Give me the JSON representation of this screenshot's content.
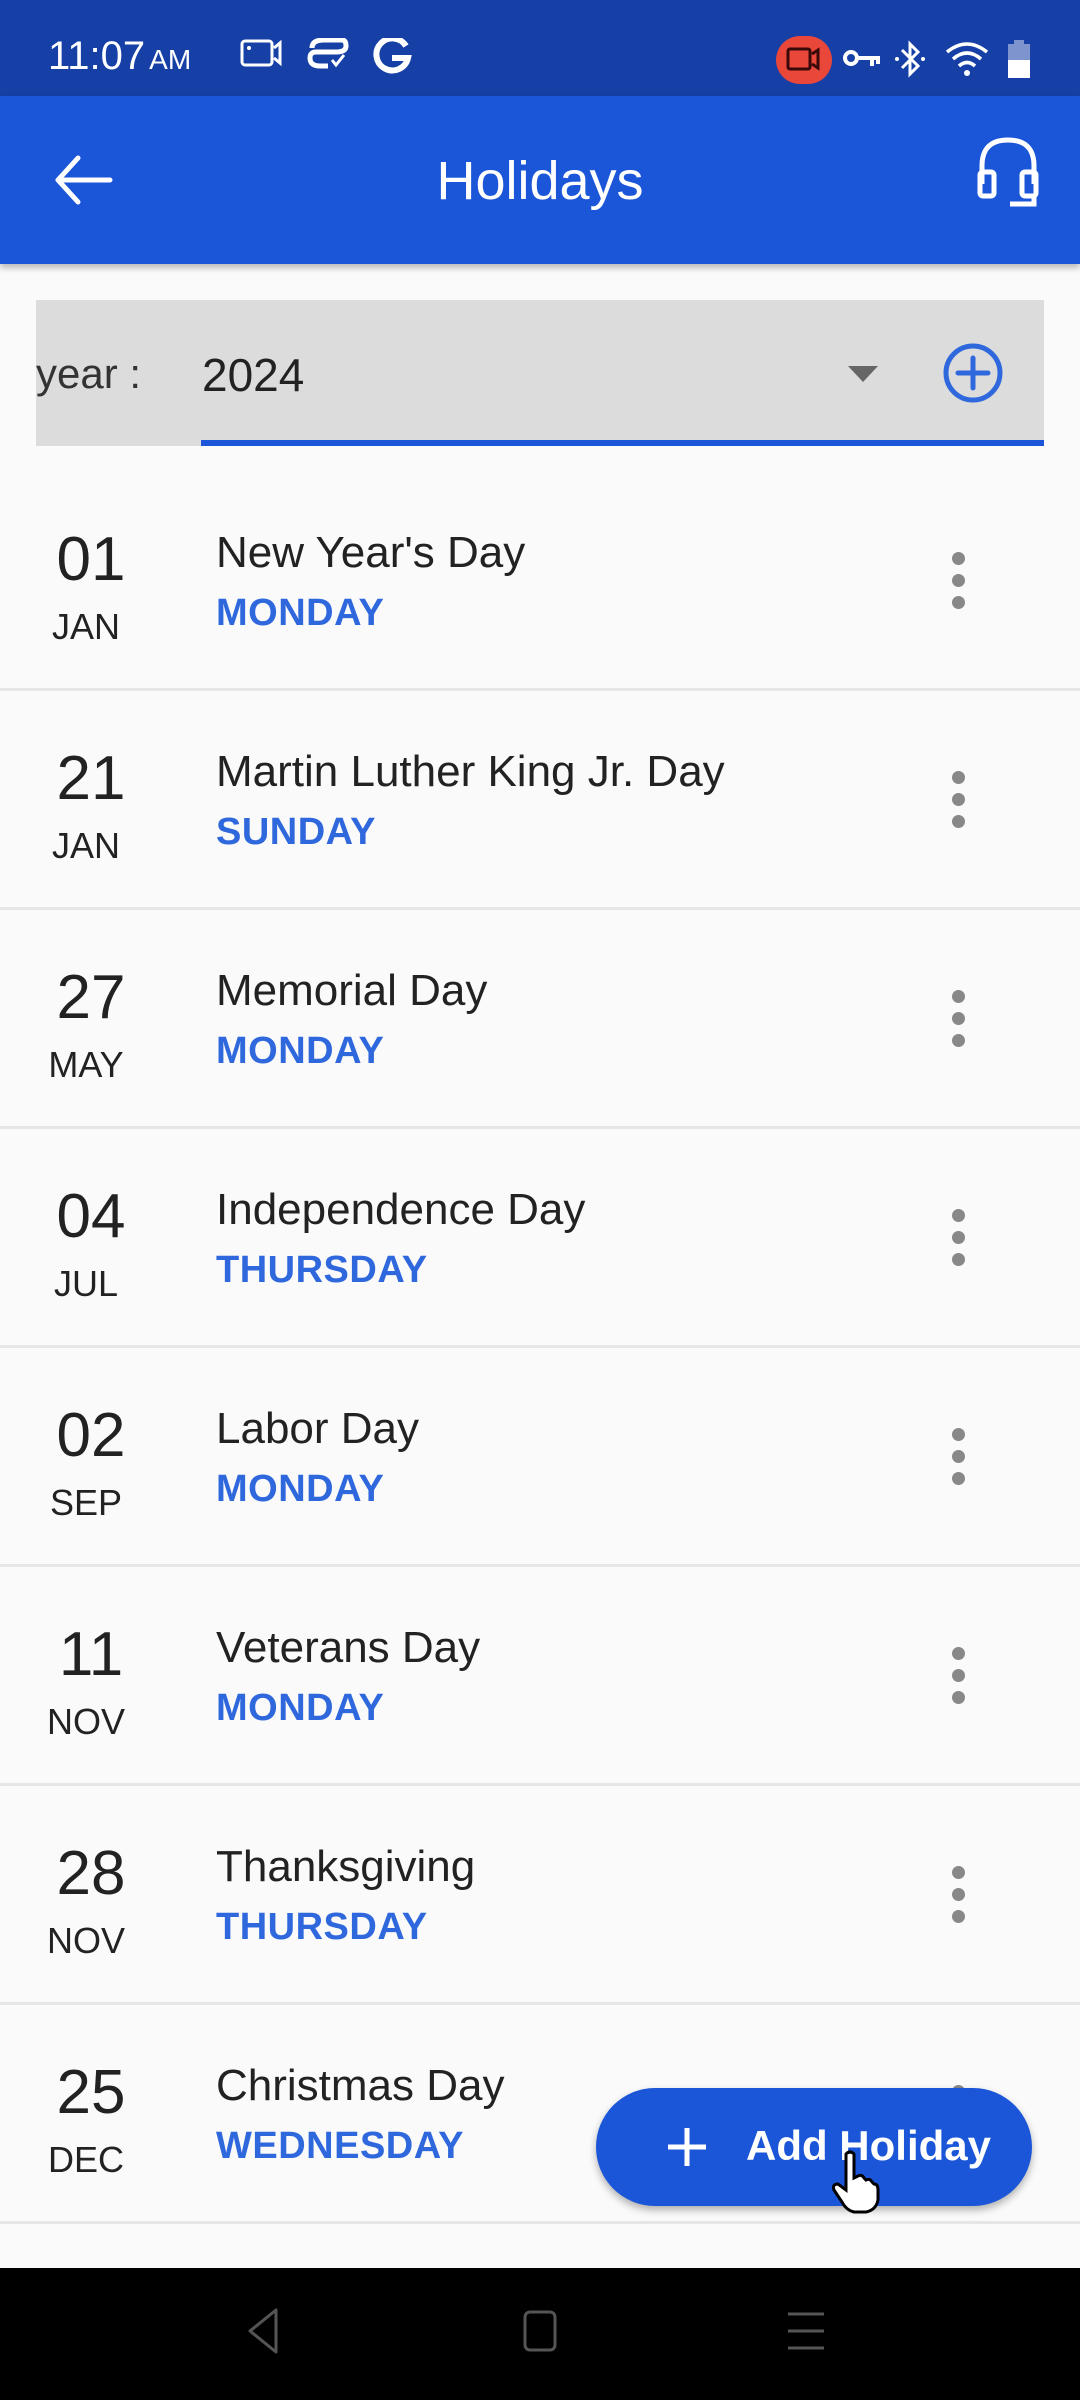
{
  "status_bar": {
    "time": "11:07",
    "ampm": "AM",
    "left_icons": [
      "screen-record-icon",
      "sync-check-icon",
      "google-icon"
    ],
    "right_icons": [
      "recording-active-icon",
      "vpn-key-icon",
      "bluetooth-icon",
      "wifi-icon",
      "battery-icon"
    ],
    "recording_color": "#e8473a"
  },
  "app_bar": {
    "title": "Holidays",
    "back_icon": "arrow-left-icon",
    "support_icon": "headset-icon",
    "color": "#1b56d8"
  },
  "year_filter": {
    "label": "year :",
    "value": "2024",
    "add_icon": "plus-circle-icon"
  },
  "holidays": [
    {
      "day": "01",
      "month": "JAN",
      "name": "New Year's Day",
      "weekday": "MONDAY"
    },
    {
      "day": "21",
      "month": "JAN",
      "name": "Martin Luther King Jr. Day",
      "weekday": "SUNDAY"
    },
    {
      "day": "27",
      "month": "MAY",
      "name": "Memorial Day",
      "weekday": "MONDAY"
    },
    {
      "day": "04",
      "month": "JUL",
      "name": "Independence Day",
      "weekday": "THURSDAY"
    },
    {
      "day": "02",
      "month": "SEP",
      "name": "Labor Day",
      "weekday": "MONDAY"
    },
    {
      "day": "11",
      "month": "NOV",
      "name": "Veterans Day",
      "weekday": "MONDAY"
    },
    {
      "day": "28",
      "month": "NOV",
      "name": "Thanksgiving",
      "weekday": "THURSDAY"
    },
    {
      "day": "25",
      "month": "DEC",
      "name": "Christmas Day",
      "weekday": "WEDNESDAY"
    }
  ],
  "fab": {
    "label": "Add Holiday",
    "icon": "plus-icon"
  },
  "nav_bar": {
    "buttons": [
      "back-nav-icon",
      "home-nav-icon",
      "recents-nav-icon"
    ]
  }
}
